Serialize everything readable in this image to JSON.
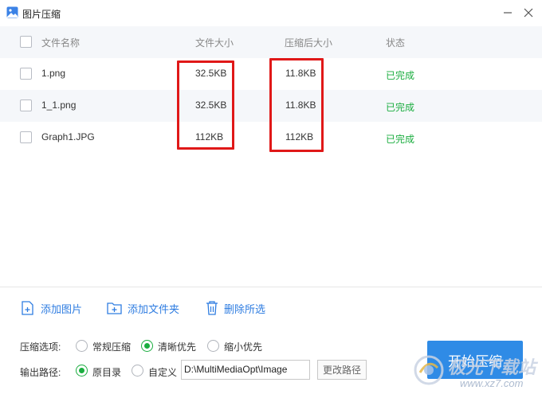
{
  "window": {
    "title": "图片压缩"
  },
  "table": {
    "headers": {
      "name": "文件名称",
      "size": "文件大小",
      "compressed_size": "压缩后大小",
      "status": "状态"
    },
    "rows": [
      {
        "name": "1.png",
        "size": "32.5KB",
        "compressed_size": "11.8KB",
        "status": "已完成"
      },
      {
        "name": "1_1.png",
        "size": "32.5KB",
        "compressed_size": "11.8KB",
        "status": "已完成"
      },
      {
        "name": "Graph1.JPG",
        "size": "112KB",
        "compressed_size": "112KB",
        "status": "已完成"
      }
    ]
  },
  "toolbar": {
    "add_image": "添加图片",
    "add_folder": "添加文件夹",
    "delete_selected": "删除所选"
  },
  "options": {
    "compress_label": "压缩选项:",
    "compress_modes": [
      {
        "label": "常规压缩",
        "selected": false
      },
      {
        "label": "清晰优先",
        "selected": true
      },
      {
        "label": "缩小优先",
        "selected": false
      }
    ],
    "output_label": "输出路径:",
    "output_modes": [
      {
        "label": "原目录",
        "selected": true
      },
      {
        "label": "自定义",
        "selected": false
      }
    ],
    "output_path": "D:\\MultiMediaOpt\\Image",
    "change_path_label": "更改路径"
  },
  "start_button": "开始压缩",
  "watermark": {
    "line1": "极光下载站",
    "line2": "www.xz7.com"
  },
  "colors": {
    "accent": "#2f8be6",
    "status_done": "#1aad3f",
    "highlight_box": "#e01818",
    "header_bg": "#f5f7fa"
  }
}
